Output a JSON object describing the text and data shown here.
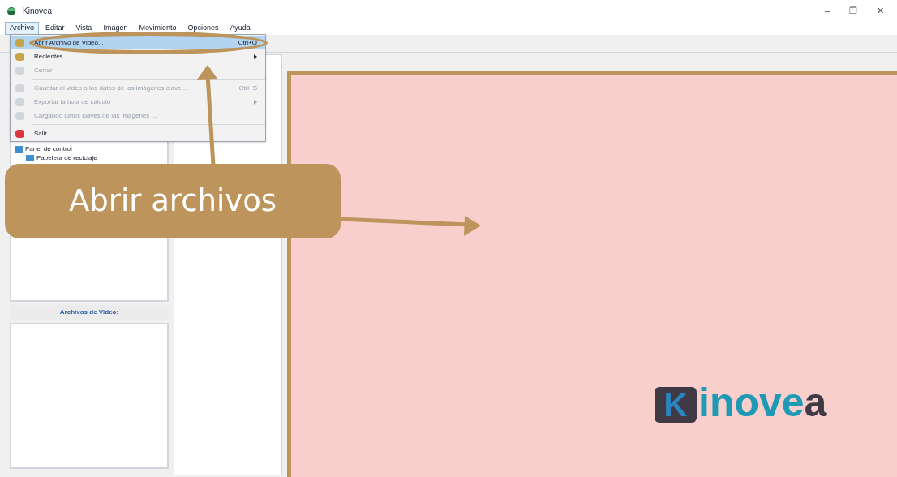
{
  "window": {
    "title": "Kinovea",
    "controls": [
      "–",
      "❐",
      "✕"
    ]
  },
  "menu_bar": [
    {
      "label": "Archivo",
      "selected": true
    },
    {
      "label": "Editar",
      "selected": false
    },
    {
      "label": "Vista",
      "selected": false
    },
    {
      "label": "Imagen",
      "selected": false
    },
    {
      "label": "Movimiento",
      "selected": false
    },
    {
      "label": "Opciones",
      "selected": false
    },
    {
      "label": "Ayuda",
      "selected": false
    }
  ],
  "file_menu": [
    {
      "kind": "item",
      "label": "Abrir Archivo de Video...",
      "shortcut": "Ctrl+O",
      "selected": true,
      "disabled": false,
      "submenu": false
    },
    {
      "kind": "item",
      "label": "Recientes",
      "selected": false,
      "disabled": false,
      "submenu": true
    },
    {
      "kind": "item",
      "label": "Cerrar",
      "selected": false,
      "disabled": true,
      "submenu": false
    },
    {
      "kind": "separator"
    },
    {
      "kind": "item",
      "label": "Guardar el video o los datos de las imágenes clave...",
      "shortcut": "Ctrl+S",
      "selected": false,
      "disabled": true,
      "submenu": false
    },
    {
      "kind": "item",
      "label": "Exportar la hoja de cálculo",
      "selected": false,
      "disabled": true,
      "submenu": true
    },
    {
      "kind": "item",
      "label": "Cargando datos claves de las imágenes ...",
      "selected": false,
      "disabled": true,
      "submenu": false
    },
    {
      "kind": "separator"
    },
    {
      "kind": "item",
      "label": "Salir",
      "selected": false,
      "disabled": false,
      "submenu": false
    }
  ],
  "folder_tree": [
    "Panel de control",
    "Papelera de reciclaje"
  ],
  "files_panel": {
    "title": "Archivos de Video:"
  },
  "logo": {
    "mark": "K",
    "text": "inove",
    "tail": "a"
  },
  "callout": {
    "text": "Abrir archivos"
  }
}
